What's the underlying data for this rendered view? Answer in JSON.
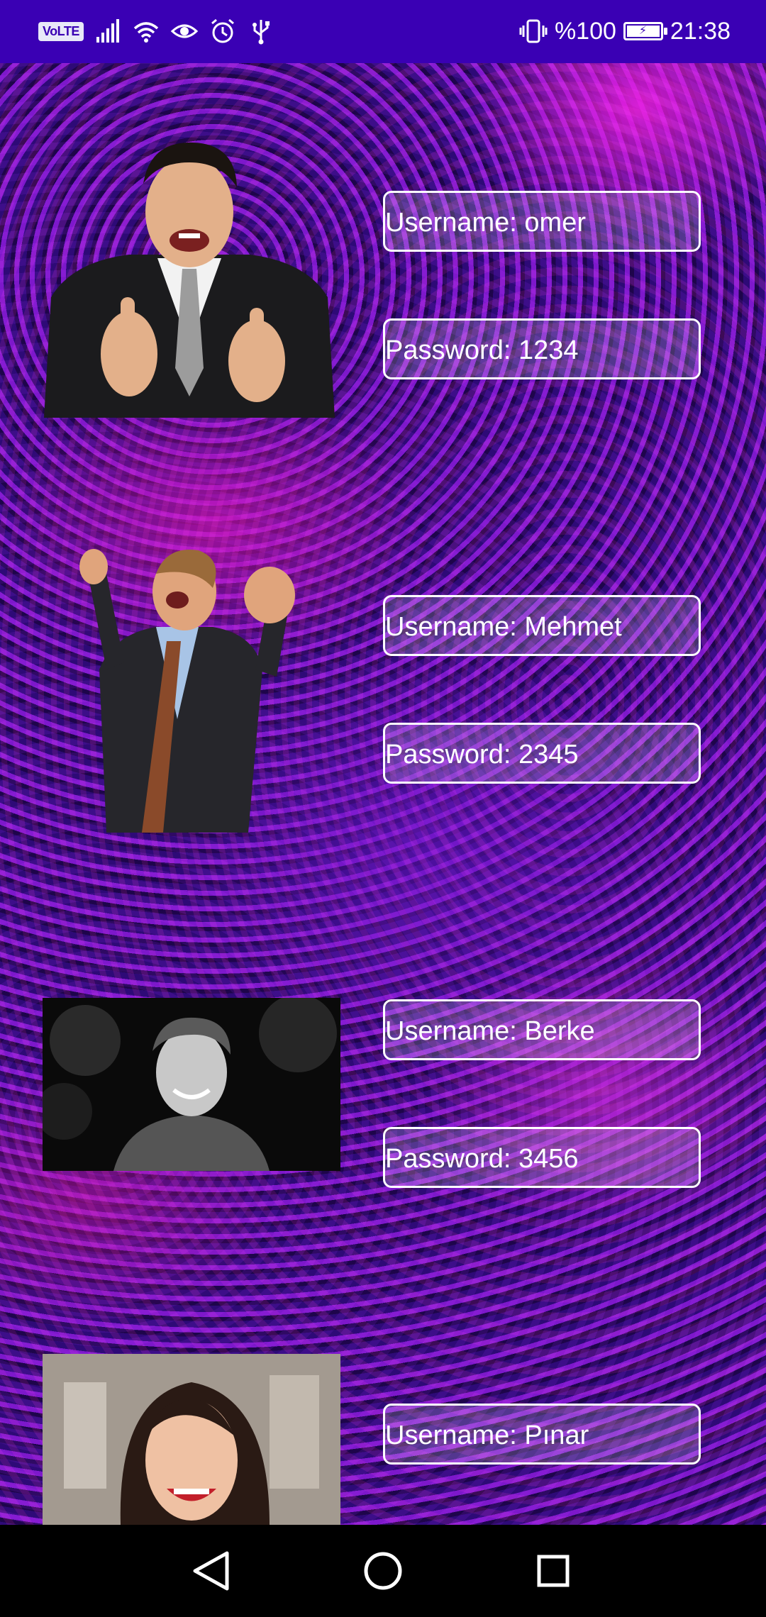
{
  "status_bar": {
    "volte": "VoLTE",
    "battery_percent": "%100",
    "time": "21:38",
    "icons": [
      "signal-icon",
      "wifi-icon",
      "eye-icon",
      "alarm-icon",
      "usb-icon",
      "vibrate-icon",
      "battery-charging-icon"
    ]
  },
  "users": [
    {
      "username_text": "Username: omer",
      "password_text": "Password: 1234"
    },
    {
      "username_text": "Username: Mehmet",
      "password_text": "Password: 2345"
    },
    {
      "username_text": "Username: Berke",
      "password_text": "Password: 3456"
    },
    {
      "username_text": "Username: Pınar"
    }
  ],
  "nav_bar": {
    "icons": [
      "back-icon",
      "home-icon",
      "recents-icon"
    ]
  },
  "colors": {
    "status_bar": "#3a00b4",
    "background_accent": "#d21aa0",
    "field_border": "#ffffff"
  }
}
